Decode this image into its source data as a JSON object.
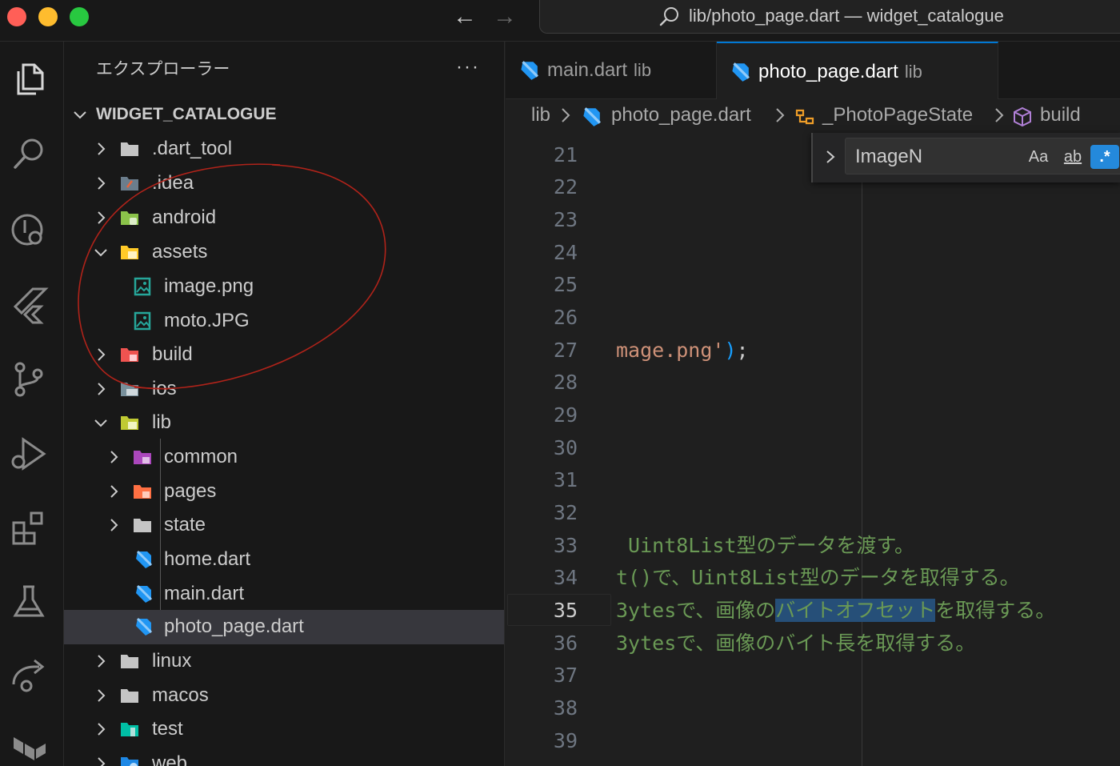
{
  "titlebar": {
    "command_center": "lib/photo_page.dart — widget_catalogue"
  },
  "sidebar": {
    "title": "エクスプローラー",
    "more": "···",
    "root": "WIDGET_CATALOGUE",
    "items": [
      {
        "label": ".dart_tool"
      },
      {
        "label": ".idea"
      },
      {
        "label": "android"
      },
      {
        "label": "assets"
      },
      {
        "label": "image.png"
      },
      {
        "label": "moto.JPG"
      },
      {
        "label": "build"
      },
      {
        "label": "ios"
      },
      {
        "label": "lib"
      },
      {
        "label": "common"
      },
      {
        "label": "pages"
      },
      {
        "label": "state"
      },
      {
        "label": "home.dart"
      },
      {
        "label": "main.dart"
      },
      {
        "label": "photo_page.dart"
      },
      {
        "label": "linux"
      },
      {
        "label": "macos"
      },
      {
        "label": "test"
      },
      {
        "label": "web"
      }
    ]
  },
  "tabs": [
    {
      "name": "main.dart",
      "desc": "lib"
    },
    {
      "name": "photo_page.dart",
      "desc": "lib"
    }
  ],
  "breadcrumbs": {
    "lib": "lib",
    "file": "photo_page.dart",
    "class": "_PhotoPageState",
    "method": "build"
  },
  "find": {
    "value": "ImageN",
    "match_case": "Aa",
    "whole_word": "ab",
    "regex": ".*"
  },
  "editor": {
    "line_numbers": [
      "21",
      "22",
      "23",
      "24",
      "25",
      "26",
      "27",
      "28",
      "29",
      "30",
      "31",
      "32",
      "33",
      "34",
      "35",
      "36",
      "37",
      "38",
      "39"
    ],
    "current_line": "35",
    "line27": {
      "str": "mage.png'",
      "paren": ")",
      "semi": ";"
    },
    "line33": " Uint8List型のデータを渡す。",
    "line34": "t()で、Uint8List型のデータを取得する。",
    "line35": {
      "before": "3ytesで、画像の",
      "highlight": "バイトオフセット",
      "after": "を取得する。"
    },
    "line36": "3ytesで、画像のバイト長を取得する。"
  }
}
